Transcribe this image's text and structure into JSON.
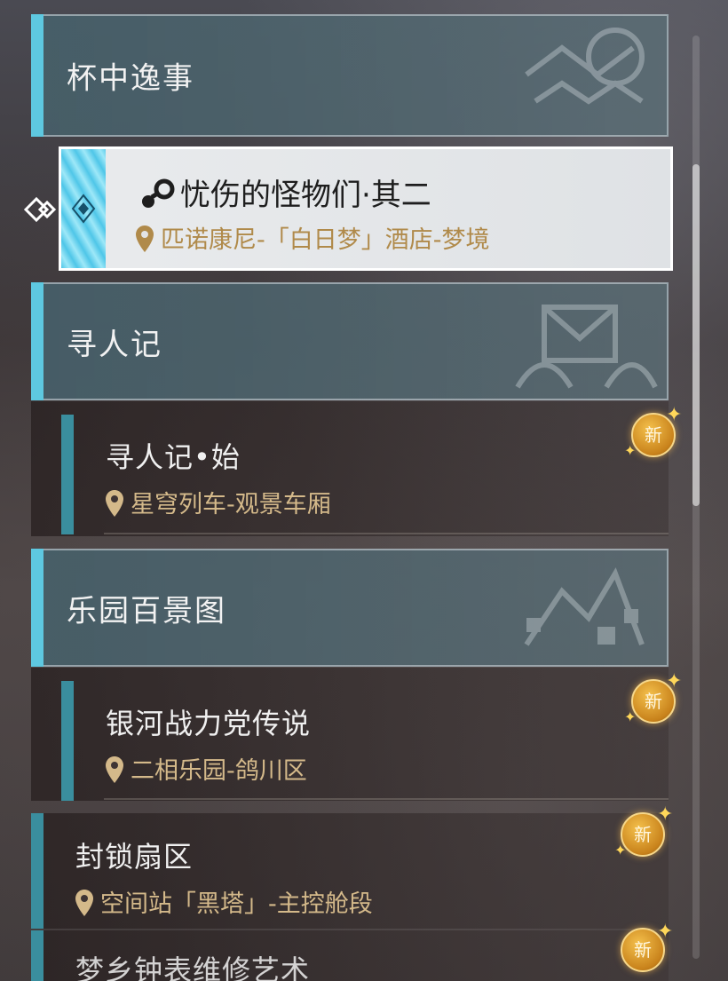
{
  "categories": [
    {
      "title": "杯中逸事"
    },
    {
      "title": "寻人记"
    },
    {
      "title": "乐园百景图"
    }
  ],
  "selected_quest": {
    "name": "忧伤的怪物们·其二",
    "location": "匹诺康尼-「白日梦」酒店-梦境"
  },
  "quests": [
    {
      "name": "寻人记•始",
      "location": "星穹列车-观景车厢",
      "badge": "新"
    },
    {
      "name": "银河战力党传说",
      "location": "二相乐园-鸽川区",
      "badge": "新"
    },
    {
      "name": "封锁扇区",
      "location": "空间站「黑塔」-主控舱段",
      "badge": "新"
    },
    {
      "name": "梦乡钟表维修艺术",
      "badge": "新"
    }
  ],
  "colors": {
    "accent": "#5ec8e0",
    "location": "#d4b98a",
    "badge": "#e0a030"
  }
}
